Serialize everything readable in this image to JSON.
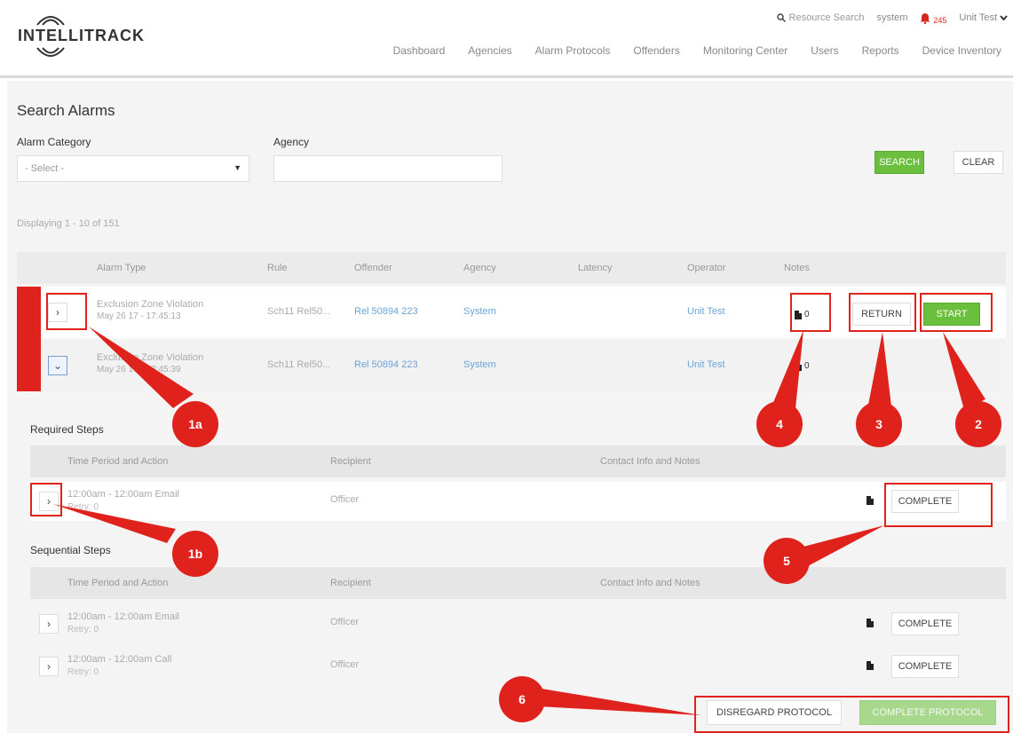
{
  "header": {
    "logo_text": "INTELLITRACK",
    "resource_search": "Resource Search",
    "system": "system",
    "bell_count": "245",
    "user": "Unit Test",
    "nav": [
      "Dashboard",
      "Agencies",
      "Alarm Protocols",
      "Offenders",
      "Monitoring Center",
      "Users",
      "Reports",
      "Device Inventory"
    ]
  },
  "search": {
    "title": "Search Alarms",
    "category_label": "Alarm Category",
    "category_value": "- Select -",
    "agency_label": "Agency",
    "agency_value": "",
    "search_button": "SEARCH",
    "clear_button": "CLEAR",
    "display_info": "Displaying 1 - 10 of 151"
  },
  "table": {
    "columns": [
      "Alarm Type",
      "Rule",
      "Offender",
      "Agency",
      "Latency",
      "Operator",
      "Notes"
    ],
    "rows": [
      {
        "type": "Exclusion Zone Violation",
        "time": "May 26 17 - 17:45:13",
        "rule": "Sch11 Rel50...",
        "offender": "Rel 50894 223",
        "agency": "System",
        "operator": "Unit Test",
        "notes": "0"
      },
      {
        "type": "Exclusion Zone Violation",
        "time": "May 26 17 - 17:45:39",
        "rule": "Sch11 Rel50...",
        "offender": "Rel 50894 223",
        "agency": "System",
        "operator": "Unit Test",
        "notes": "0"
      }
    ],
    "return_button": "RETURN",
    "start_button": "START"
  },
  "required": {
    "title": "Required Steps",
    "columns": [
      "Time Period and Action",
      "Recipient",
      "Contact Info and Notes"
    ],
    "rows": [
      {
        "action": "12:00am - 12:00am Email",
        "retry": "Retry: 0",
        "recipient": "Officer",
        "button": "COMPLETE"
      }
    ]
  },
  "sequential": {
    "title": "Sequential Steps",
    "columns": [
      "Time Period and Action",
      "Recipient",
      "Contact Info and Notes"
    ],
    "rows": [
      {
        "action": "12:00am - 12:00am Email",
        "retry": "Retry: 0",
        "recipient": "Officer",
        "button": "COMPLETE"
      },
      {
        "action": "12:00am - 12:00am Call",
        "retry": "Retry: 0",
        "recipient": "Officer",
        "button": "COMPLETE"
      }
    ]
  },
  "footer": {
    "disregard": "DISREGARD PROTOCOL",
    "complete": "COMPLETE PROTOCOL"
  },
  "annotations": [
    "1a",
    "1b",
    "2",
    "3",
    "4",
    "5",
    "6"
  ],
  "colors": {
    "accent_red": "#e0221c",
    "green": "#6abf3c",
    "link_blue": "#6aa3d8"
  }
}
